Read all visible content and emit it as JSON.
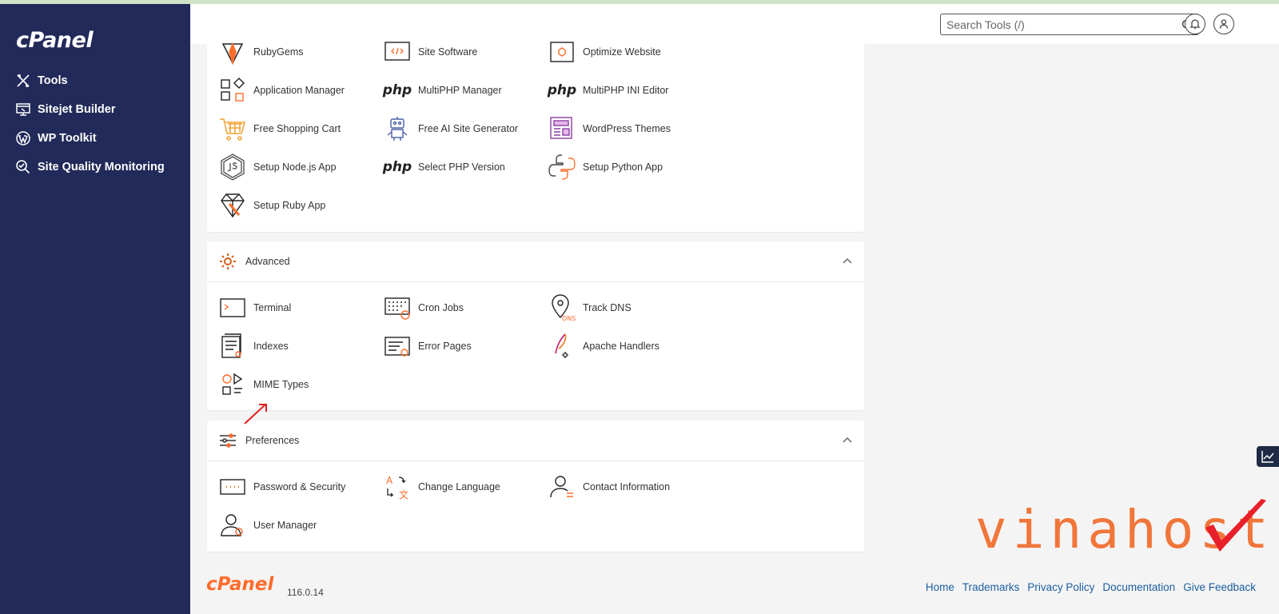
{
  "app": {
    "logo": "cPanel",
    "version": "116.0.14"
  },
  "sidebar": {
    "items": [
      {
        "label": "Tools",
        "icon": "tools-icon"
      },
      {
        "label": "Sitejet Builder",
        "icon": "sitejet-icon"
      },
      {
        "label": "WP Toolkit",
        "icon": "wordpress-icon"
      },
      {
        "label": "Site Quality Monitoring",
        "icon": "site-quality-icon"
      }
    ]
  },
  "header": {
    "search_placeholder": "Search Tools (/)"
  },
  "software_section": {
    "tools": [
      {
        "label": "RubyGems",
        "icon": "rubygems-icon"
      },
      {
        "label": "Site Software",
        "icon": "site-software-icon"
      },
      {
        "label": "Optimize Website",
        "icon": "optimize-website-icon"
      },
      {
        "label": "Application Manager",
        "icon": "application-manager-icon"
      },
      {
        "label": "MultiPHP Manager",
        "icon": "php-icon"
      },
      {
        "label": "MultiPHP INI Editor",
        "icon": "php-icon"
      },
      {
        "label": "Free Shopping Cart",
        "icon": "shopping-cart-icon"
      },
      {
        "label": "Free AI Site Generator",
        "icon": "robot-icon"
      },
      {
        "label": "WordPress Themes",
        "icon": "wordpress-themes-icon"
      },
      {
        "label": "Setup Node.js App",
        "icon": "nodejs-icon"
      },
      {
        "label": "Select PHP Version",
        "icon": "php-icon"
      },
      {
        "label": "Setup Python App",
        "icon": "python-icon"
      },
      {
        "label": "Setup Ruby App",
        "icon": "ruby-icon"
      }
    ]
  },
  "advanced_section": {
    "title": "Advanced",
    "tools": [
      {
        "label": "Terminal",
        "icon": "terminal-icon"
      },
      {
        "label": "Cron Jobs",
        "icon": "cron-jobs-icon"
      },
      {
        "label": "Track DNS",
        "icon": "track-dns-icon"
      },
      {
        "label": "Indexes",
        "icon": "indexes-icon"
      },
      {
        "label": "Error Pages",
        "icon": "error-pages-icon"
      },
      {
        "label": "Apache Handlers",
        "icon": "apache-handlers-icon"
      },
      {
        "label": "MIME Types",
        "icon": "mime-types-icon"
      }
    ]
  },
  "preferences_section": {
    "title": "Preferences",
    "tools": [
      {
        "label": "Password & Security",
        "icon": "password-icon"
      },
      {
        "label": "Change Language",
        "icon": "language-icon"
      },
      {
        "label": "Contact Information",
        "icon": "contact-icon"
      },
      {
        "label": "User Manager",
        "icon": "user-manager-icon"
      }
    ]
  },
  "footer": {
    "logo": "cPanel",
    "links": [
      "Home",
      "Trademarks",
      "Privacy Policy",
      "Documentation",
      "Give Feedback"
    ]
  },
  "watermark": {
    "text": "vinahost."
  },
  "colors": {
    "sidebar": "#222a5a",
    "accent": "#ff6c2c",
    "link": "#1b5e9e",
    "watermark_check": "#e8202a"
  }
}
